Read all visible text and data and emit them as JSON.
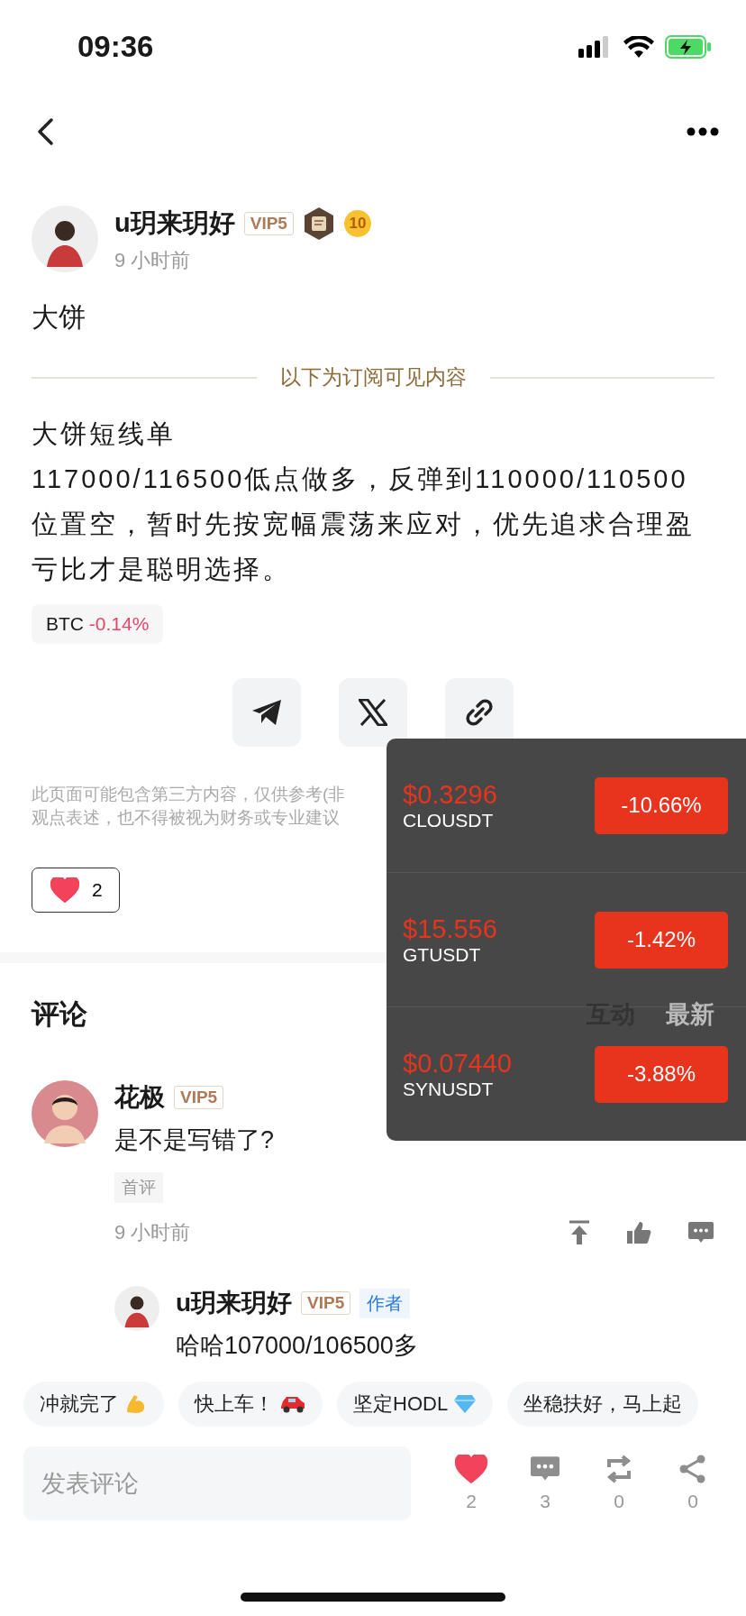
{
  "status_bar": {
    "time": "09:36"
  },
  "post": {
    "author": {
      "name": "u玥来玥好",
      "vip": "VIP5",
      "level_badge": "10"
    },
    "time": "9 小时前",
    "title": "大饼",
    "paywall_label": "以下为订阅可见内容",
    "body": [
      "大饼短线单",
      "117000/116500低点做多，反弹到110000/110500位置空，暂时先按宽幅震荡来应对，优先追求合理盈亏比才是聪明选择。"
    ],
    "coin_tag": {
      "symbol": "BTC",
      "change": "-0.14%"
    },
    "disclaimer": [
      "此页面可能包含第三方内容，仅供参考(非",
      "观点表述，也不得被视为财务或专业建议"
    ],
    "like": {
      "count": "2",
      "liked": true
    }
  },
  "comments_section": {
    "title": "评论",
    "sort_tabs": [
      {
        "label": "互动",
        "selected": true
      },
      {
        "label": "最新",
        "selected": false
      }
    ],
    "comments": [
      {
        "name": "花极",
        "vip": "VIP5",
        "text": "是不是写错了?",
        "tag": "首评",
        "time": "9 小时前",
        "replies": [
          {
            "name": "u玥来玥好",
            "vip": "VIP5",
            "author_tag": "作者",
            "text": "哈哈107000/106500多"
          }
        ]
      }
    ]
  },
  "quick_replies": [
    "冲就完了",
    "快上车！",
    "坚定HODL",
    "坐稳扶好，马上起"
  ],
  "bottom_bar": {
    "placeholder": "发表评论",
    "like": {
      "count": "2",
      "liked": true
    },
    "comments": "3",
    "reposts": "0",
    "shares": "0"
  },
  "ticker_popup": [
    {
      "price": "$0.3296",
      "symbol": "CLOUSDT",
      "change": "-10.66%"
    },
    {
      "price": "$15.556",
      "symbol": "GTUSDT",
      "change": "-1.42%"
    },
    {
      "price": "$0.07440",
      "symbol": "SYNUSDT",
      "change": "-3.88%"
    }
  ]
}
